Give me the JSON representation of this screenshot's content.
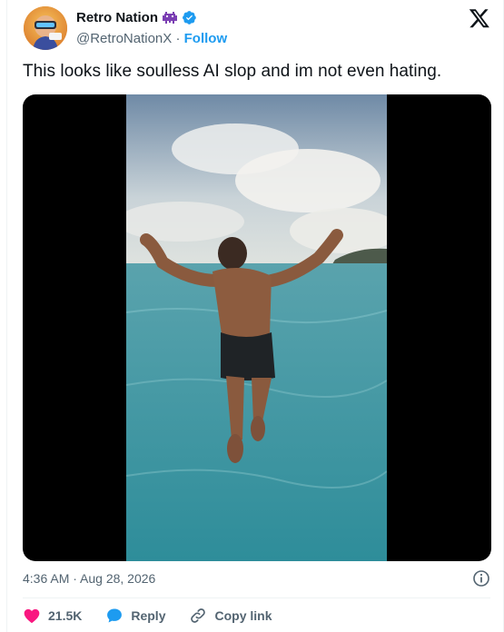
{
  "author": {
    "display_name": "Retro Nation",
    "handle": "@RetroNationX",
    "separator": "·",
    "follow_label": "Follow",
    "verified_color": "#1d9bf0",
    "emoji_icon": "alien-monster-icon"
  },
  "tweet": {
    "text": "This looks like soulless AI slop and im not even hating."
  },
  "media": {
    "type": "video",
    "description_icon": "video-thumbnail"
  },
  "meta": {
    "timestamp": "4:36 AM · Aug 28, 2026"
  },
  "actions": {
    "like_count": "21.5K",
    "reply_label": "Reply",
    "copy_link_label": "Copy link"
  },
  "colors": {
    "like": "#f91880",
    "reply": "#1d9bf0",
    "link": "#1d9bf0",
    "text_secondary": "#536471"
  }
}
